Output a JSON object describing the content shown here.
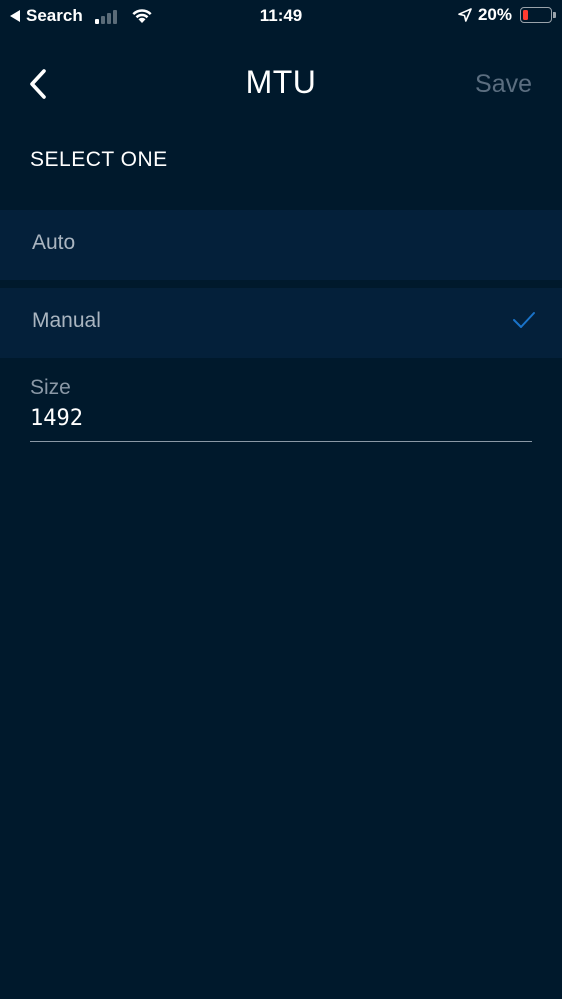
{
  "status_bar": {
    "back_app": "Search",
    "time": "11:49",
    "battery_percent": "20%",
    "battery_level": 0.2,
    "signal_bars_active": 1,
    "signal_bars_total": 4
  },
  "nav": {
    "title": "MTU",
    "save_label": "Save"
  },
  "section": {
    "header": "SELECT ONE"
  },
  "options": [
    {
      "label": "Auto",
      "selected": false
    },
    {
      "label": "Manual",
      "selected": true
    }
  ],
  "size_field": {
    "label": "Size",
    "value": "1492"
  },
  "colors": {
    "background": "#00192c",
    "row_background": "#04203a",
    "accent": "#1a73c9",
    "battery_low": "#ff3b30",
    "save_disabled": "#5b6e80"
  },
  "icons": {
    "back": "chevron-left-icon",
    "check": "checkmark-icon",
    "wifi": "wifi-icon",
    "location": "location-arrow-icon"
  }
}
